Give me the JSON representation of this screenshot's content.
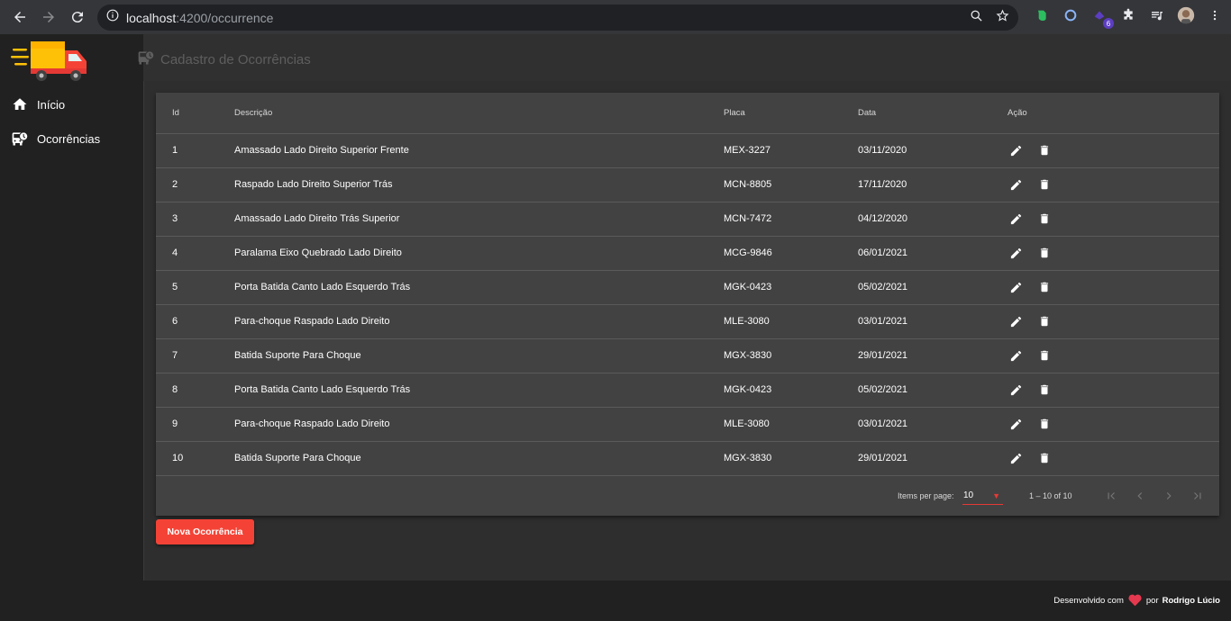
{
  "browser": {
    "url_host": "localhost",
    "url_path": ":4200/occurrence",
    "extension_badge": "6"
  },
  "sidebar": {
    "items": [
      {
        "label": "Início",
        "icon": "home-icon"
      },
      {
        "label": "Ocorrências",
        "icon": "bus-clock-icon"
      }
    ]
  },
  "header": {
    "title": "Cadastro de Ocorrências"
  },
  "table": {
    "columns": [
      "Id",
      "Descrição",
      "Placa",
      "Data",
      "Ação"
    ],
    "rows": [
      {
        "id": "1",
        "descricao": "Amassado Lado Direito Superior Frente",
        "placa": "MEX-3227",
        "data": "03/11/2020"
      },
      {
        "id": "2",
        "descricao": "Raspado Lado Direito Superior Trás",
        "placa": "MCN-8805",
        "data": "17/11/2020"
      },
      {
        "id": "3",
        "descricao": "Amassado Lado Direito Trás Superior",
        "placa": "MCN-7472",
        "data": "04/12/2020"
      },
      {
        "id": "4",
        "descricao": "Paralama Eixo Quebrado Lado Direito",
        "placa": "MCG-9846",
        "data": "06/01/2021"
      },
      {
        "id": "5",
        "descricao": "Porta Batida Canto Lado Esquerdo Trás",
        "placa": "MGK-0423",
        "data": "05/02/2021"
      },
      {
        "id": "6",
        "descricao": "Para-choque Raspado Lado Direito",
        "placa": "MLE-3080",
        "data": "03/01/2021"
      },
      {
        "id": "7",
        "descricao": "Batida Suporte Para Choque",
        "placa": "MGX-3830",
        "data": "29/01/2021"
      },
      {
        "id": "8",
        "descricao": "Porta Batida Canto Lado Esquerdo Trás",
        "placa": "MGK-0423",
        "data": "05/02/2021"
      },
      {
        "id": "9",
        "descricao": "Para-choque Raspado Lado Direito",
        "placa": "MLE-3080",
        "data": "03/01/2021"
      },
      {
        "id": "10",
        "descricao": "Batida Suporte Para Choque",
        "placa": "MGX-3830",
        "data": "29/01/2021"
      }
    ]
  },
  "paginator": {
    "items_per_page_label": "Items per page:",
    "items_per_page_value": "10",
    "range": "1 – 10 of 10"
  },
  "new_button_label": "Nova Ocorrência",
  "footer": {
    "prefix": "Desenvolvido com",
    "middle": "por",
    "author": "Rodrigo Lúcio"
  },
  "colors": {
    "accent": "#f44336",
    "logo_truck": "#f44336",
    "logo_cargo": "#ffc107",
    "heart": "#e53950"
  }
}
